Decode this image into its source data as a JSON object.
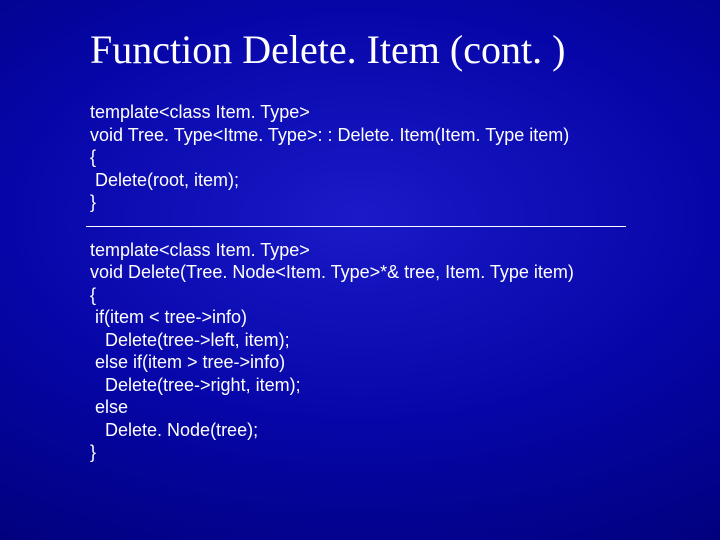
{
  "title": "Function Delete. Item (cont. )",
  "code_block_1": "template<class Item. Type>\nvoid Tree. Type<Itme. Type>: : Delete. Item(Item. Type item)\n{\n Delete(root, item);\n}",
  "code_block_2": "template<class Item. Type>\nvoid Delete(Tree. Node<Item. Type>*& tree, Item. Type item)\n{\n if(item < tree->info)\n   Delete(tree->left, item);\n else if(item > tree->info)\n   Delete(tree->right, item);\n else\n   Delete. Node(tree);\n}"
}
